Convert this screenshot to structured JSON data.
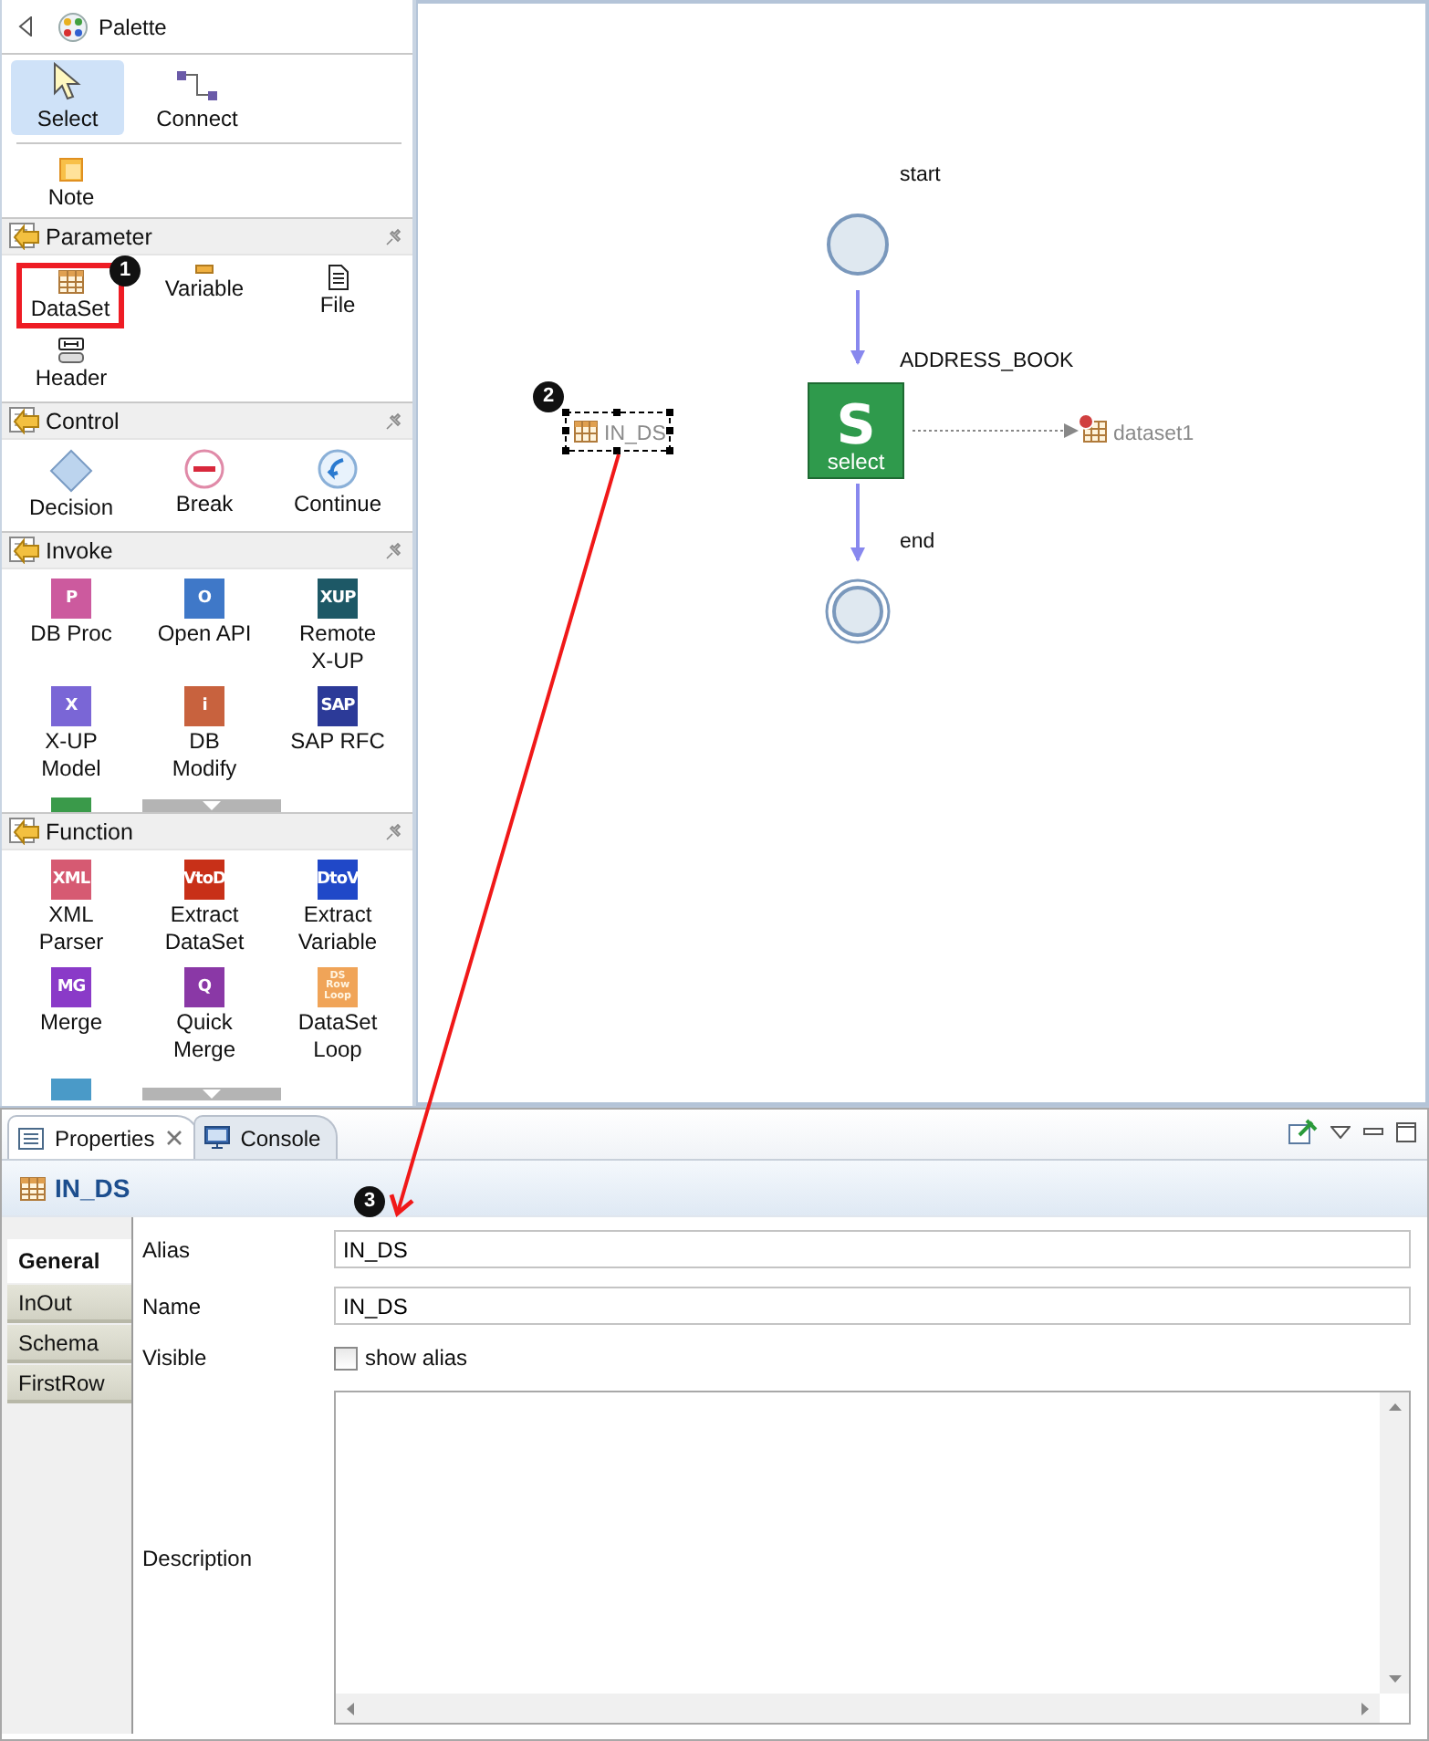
{
  "palette": {
    "title": "Palette",
    "tools": [
      {
        "kind": "pointer",
        "label": "Select",
        "selected": true
      },
      {
        "kind": "connector",
        "label": "Connect",
        "selected": false
      }
    ],
    "note": {
      "kind": "note",
      "label": "Note"
    },
    "sections": [
      {
        "title": "Parameter",
        "items": [
          {
            "kind": "table",
            "label": "DataSet",
            "highlighted": true
          },
          {
            "kind": "bar",
            "label": "Variable",
            "highlighted": false
          },
          {
            "kind": "page",
            "label": "File",
            "highlighted": false
          },
          {
            "kind": "header",
            "label": "Header",
            "highlighted": false
          }
        ]
      },
      {
        "title": "Control",
        "items": [
          {
            "kind": "diamond",
            "label": "Decision",
            "highlighted": false
          },
          {
            "kind": "minus-circle",
            "label": "Break",
            "highlighted": false
          },
          {
            "kind": "circle-arrow",
            "label": "Continue",
            "highlighted": false
          }
        ]
      },
      {
        "title": "Invoke",
        "overflow": {
          "color": "#3a9a4a"
        },
        "items": [
          {
            "kind": "badge",
            "badge": "P",
            "color": "#cc5a9e",
            "label": "DB Proc",
            "highlighted": false
          },
          {
            "kind": "badge",
            "badge": "O",
            "color": "#3f78c8",
            "label": "Open API",
            "highlighted": false
          },
          {
            "kind": "badge",
            "badge": "XUP",
            "color": "#1d5866",
            "label": "Remote\nX-UP",
            "highlighted": false
          },
          {
            "kind": "badge",
            "badge": "X",
            "color": "#7a66d6",
            "label": "X-UP\nModel",
            "highlighted": false
          },
          {
            "kind": "badge",
            "badge": "i",
            "color": "#c8623e",
            "label": "DB\nModify",
            "highlighted": false
          },
          {
            "kind": "badge",
            "badge": "SAP",
            "color": "#2c3a98",
            "label": "SAP RFC",
            "highlighted": false
          }
        ]
      },
      {
        "title": "Function",
        "overflow": {
          "color": "#4a9ac8"
        },
        "items": [
          {
            "kind": "badge",
            "badge": "XML",
            "color": "#d65a72",
            "label": "XML\nParser",
            "highlighted": false
          },
          {
            "kind": "badge",
            "badge": "VtoD",
            "color": "#c83018",
            "label": "Extract\nDataSet",
            "highlighted": false
          },
          {
            "kind": "badge",
            "badge": "DtoV",
            "color": "#2048c8",
            "label": "Extract\nVariable",
            "highlighted": false
          },
          {
            "kind": "badge",
            "badge": "MG",
            "color": "#8a3ac8",
            "label": "Merge",
            "highlighted": false
          },
          {
            "kind": "badge",
            "badge": "Q",
            "color": "#8a38a6",
            "label": "Quick\nMerge",
            "highlighted": false
          },
          {
            "kind": "badge",
            "badge": "DS Row Loop",
            "color": "#f0a458",
            "label": "DataSet\nLoop",
            "highlighted": false
          }
        ]
      }
    ]
  },
  "canvas": {
    "nodes": [
      {
        "kind": "start",
        "label": "start"
      },
      {
        "kind": "task",
        "label": "ADDRESS_BOOK",
        "glyph": "S",
        "caption": "select"
      },
      {
        "kind": "end",
        "label": "end"
      },
      {
        "kind": "output",
        "label": "dataset1"
      },
      {
        "kind": "parameter",
        "label": "IN_DS",
        "selected": true
      }
    ]
  },
  "callouts": [
    "1",
    "2",
    "3"
  ],
  "properties": {
    "tabs": [
      {
        "label": "Properties",
        "selected": true,
        "closable": true
      },
      {
        "label": "Console",
        "selected": false,
        "closable": false
      }
    ],
    "title": "IN_DS",
    "side_tabs": [
      {
        "label": "General",
        "selected": true
      },
      {
        "label": "InOut",
        "selected": false
      },
      {
        "label": "Schema",
        "selected": false
      },
      {
        "label": "FirstRow",
        "selected": false
      }
    ],
    "fields": [
      {
        "kind": "text",
        "label": "Alias",
        "value": "IN_DS"
      },
      {
        "kind": "text",
        "label": "Name",
        "value": "IN_DS"
      },
      {
        "kind": "checkbox",
        "label": "Visible",
        "text": "show alias",
        "checked": false
      },
      {
        "kind": "textarea",
        "label": "Description"
      }
    ]
  }
}
